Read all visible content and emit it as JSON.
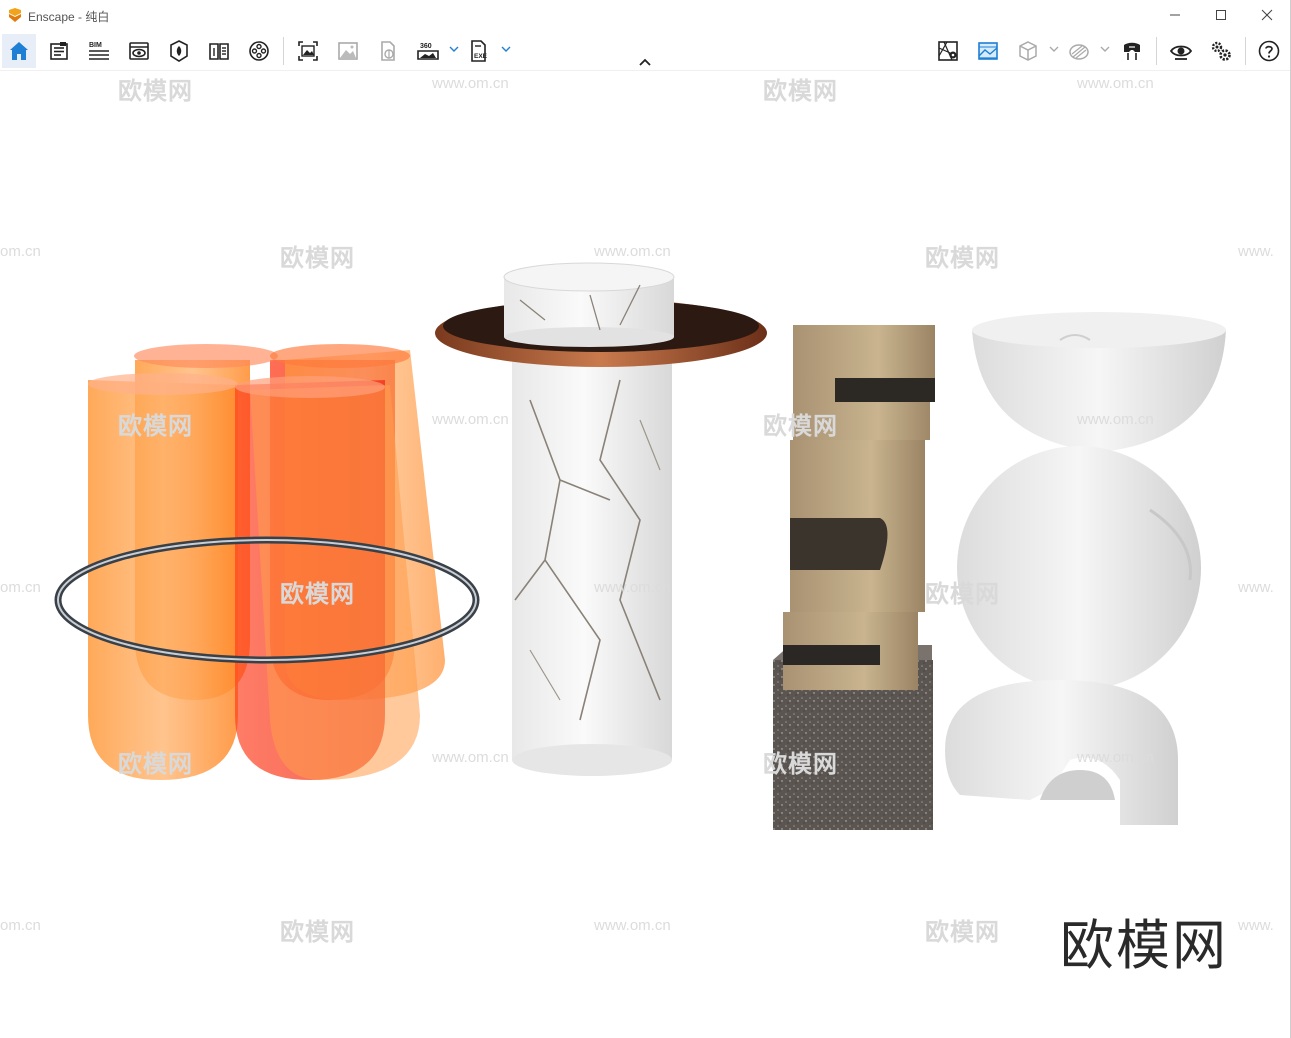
{
  "window": {
    "title": "Enscape - 纯白",
    "minimize_glyph": "—",
    "maximize_glyph": "☐",
    "close_glyph": "✕"
  },
  "toolbar": {
    "left_tools": [
      {
        "name": "home-icon",
        "label": ""
      },
      {
        "name": "object-library-icon",
        "label": ""
      },
      {
        "name": "bim-info-icon",
        "label": "BIM"
      },
      {
        "name": "view-management-icon",
        "label": ""
      },
      {
        "name": "asset-library-icon",
        "label": ""
      },
      {
        "name": "material-editor-icon",
        "label": ""
      },
      {
        "name": "video-editor-icon",
        "label": ""
      },
      {
        "name": "screenshot-icon",
        "label": ""
      },
      {
        "name": "batch-render-icon",
        "label": ""
      },
      {
        "name": "web-standalone-icon",
        "label": ""
      },
      {
        "name": "panorama-360-icon",
        "label": "360"
      },
      {
        "name": "exe-export-icon",
        "label": "EXE"
      }
    ],
    "right_tools": [
      {
        "name": "map-icon"
      },
      {
        "name": "atmosphere-icon"
      },
      {
        "name": "cube-view-icon"
      },
      {
        "name": "light-view-icon"
      },
      {
        "name": "vr-headset-icon"
      },
      {
        "name": "eye-view-icon"
      },
      {
        "name": "settings-icon"
      },
      {
        "name": "help-icon"
      }
    ],
    "accent_color": "#1e7fd4"
  },
  "viewport": {
    "watermark_text": "欧模网",
    "watermark_url": "www.om.cn",
    "watermark_partial_left": "om.cn",
    "watermark_partial_right": "www.",
    "brand_text": "欧模网"
  }
}
